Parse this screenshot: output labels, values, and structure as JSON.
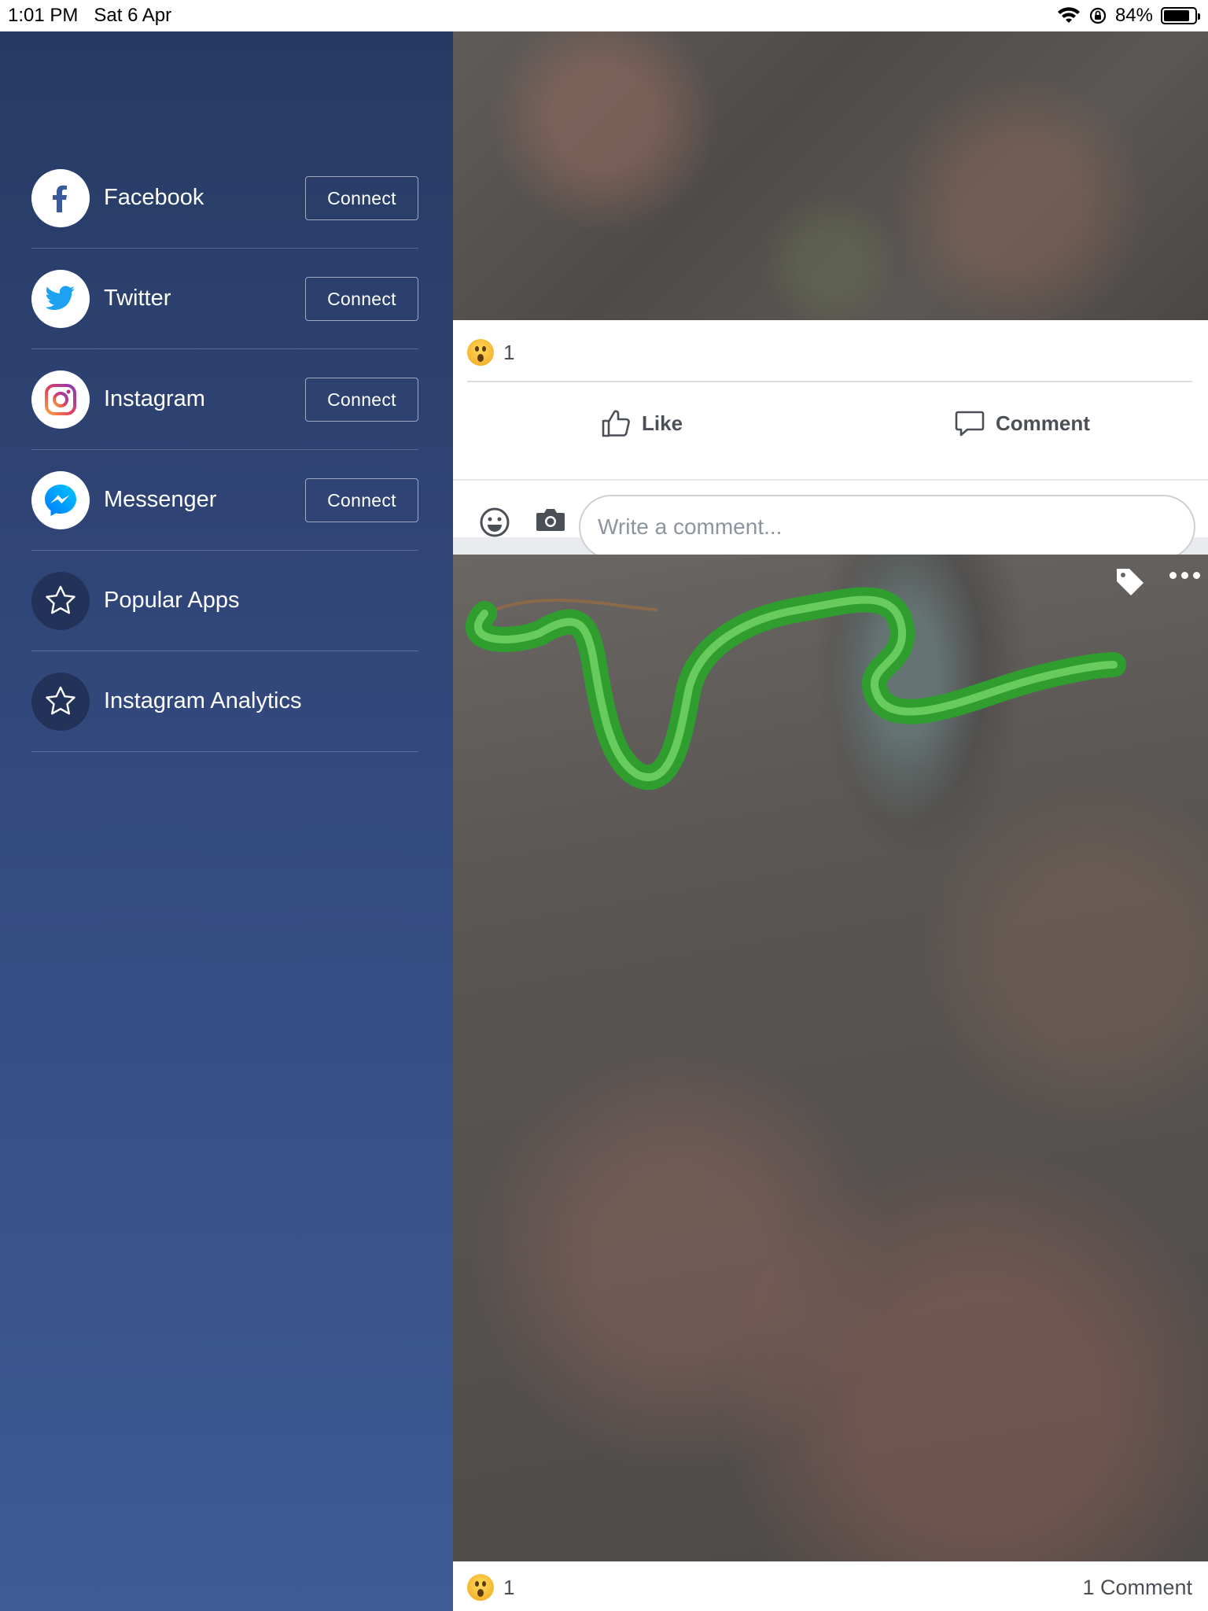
{
  "status_bar": {
    "time": "1:01 PM",
    "date": "Sat 6 Apr",
    "battery": "84%",
    "battery_level": 0.84
  },
  "sidebar": {
    "items": [
      {
        "label": "Facebook",
        "icon": "facebook-icon",
        "button": "Connect"
      },
      {
        "label": "Twitter",
        "icon": "twitter-icon",
        "button": "Connect"
      },
      {
        "label": "Instagram",
        "icon": "instagram-icon",
        "button": "Connect"
      },
      {
        "label": "Messenger",
        "icon": "messenger-icon",
        "button": "Connect"
      },
      {
        "label": "Popular Apps",
        "icon": "star-icon"
      },
      {
        "label": "Instagram Analytics",
        "icon": "star-icon"
      }
    ],
    "colors": {
      "top": "#273a64",
      "bottom": "#3f5a94"
    }
  },
  "feed": {
    "post1": {
      "reaction_count": "1",
      "like_label": "Like",
      "comment_label": "Comment",
      "comment_placeholder": "Write a comment..."
    },
    "post2": {
      "reaction_count": "1",
      "comment_count": "1 Comment"
    }
  }
}
